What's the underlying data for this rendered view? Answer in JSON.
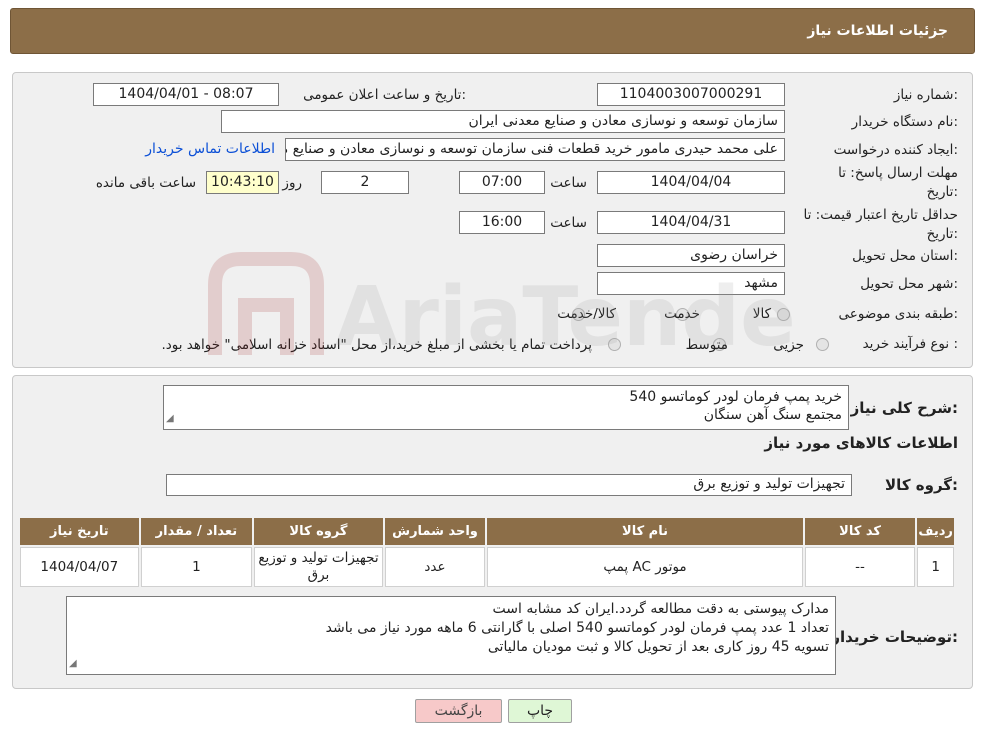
{
  "header": {
    "title": "جزئیات اطلاعات نیاز"
  },
  "form": {
    "need_number_label": "شماره نیاز:",
    "need_number": "1104003007000291",
    "announce_label": "تاریخ و ساعت اعلان عمومی:",
    "announce_value": "1404/04/01 - 08:07",
    "buyer_org_label": "نام دستگاه خریدار:",
    "buyer_org": "سازمان توسعه و نوسازی معادن و صنایع معدنی ایران",
    "creator_label": "ایجاد کننده درخواست:",
    "creator": "علی محمد حیدری مامور خرید قطعات فنی سازمان توسعه و نوسازی معادن و صنایع معدنی ایران",
    "contact_link": "اطلاعات تماس خریدار",
    "reply_deadline_label_1": "مهلت ارسال پاسخ: تا",
    "reply_deadline_label_2": "تاریخ:",
    "reply_date": "1404/04/04",
    "time_label": "ساعت",
    "reply_time": "07:00",
    "days_value": "2",
    "days_label": "روز و",
    "remaining_time": "10:43:10",
    "remaining_label": "ساعت باقی مانده",
    "price_deadline_label_1": "حداقل تاریخ اعتبار قیمت: تا",
    "price_deadline_label_2": "تاریخ:",
    "price_date": "1404/04/31",
    "price_time_label": "ساعت",
    "price_time": "16:00",
    "province_label": "استان محل تحویل:",
    "province": "خراسان رضوی",
    "city_label": "شهر محل تحویل:",
    "city": "مشهد",
    "category_label": "طبقه بندی موضوعی:",
    "category_options": [
      "کالا",
      "خدمت",
      "کالا/خدمت"
    ],
    "purchase_type_label": "نوع فرآیند خرید :",
    "purchase_options": [
      "جزیی",
      "متوسط"
    ],
    "purchase_note": "پرداخت تمام یا بخشی از مبلغ خرید،از محل \"اسناد خزانه اسلامی\" خواهد بود."
  },
  "details": {
    "summary_label": "شرح کلی نیاز:",
    "summary_line1": "خرید پمپ فرمان لودر کوماتسو 540",
    "summary_line2": "مجتمع سنگ آهن سنگان",
    "goods_info_title": "اطلاعات کالاهای مورد نیاز",
    "goods_group_label": "گروه کالا:",
    "goods_group": "تجهیزات تولید و توزیع برق"
  },
  "table": {
    "headers": [
      "ردیف",
      "کد کالا",
      "نام کالا",
      "واحد شمارش",
      "گروه کالا",
      "تعداد / مقدار",
      "تاریخ نیاز"
    ],
    "rows": [
      [
        "1",
        "--",
        "موتور AC پمپ",
        "عدد",
        "تجهیزات تولید و توزیع برق",
        "1",
        "1404/04/07"
      ]
    ]
  },
  "buyer_notes": {
    "label": "توضیحات خریدار:",
    "line1": "مدارک پیوستی به دقت مطالعه گردد.ایران کد مشابه است",
    "line2": "تعداد 1 عدد پمپ فرمان لودر کوماتسو 540  اصلی با گارانتی 6 ماهه مورد نیاز می باشد",
    "line3": "تسویه 45 روز کاری بعد از تحویل کالا و ثبت مودیان مالیاتی"
  },
  "buttons": {
    "print": "چاپ",
    "back": "بازگشت"
  },
  "colors": {
    "header": "#8c6e48",
    "link": "#0b4fd6",
    "remaining_bg": "#ffffcc",
    "back_button": "#f7c9c9",
    "print_button": "#dff7d6"
  }
}
